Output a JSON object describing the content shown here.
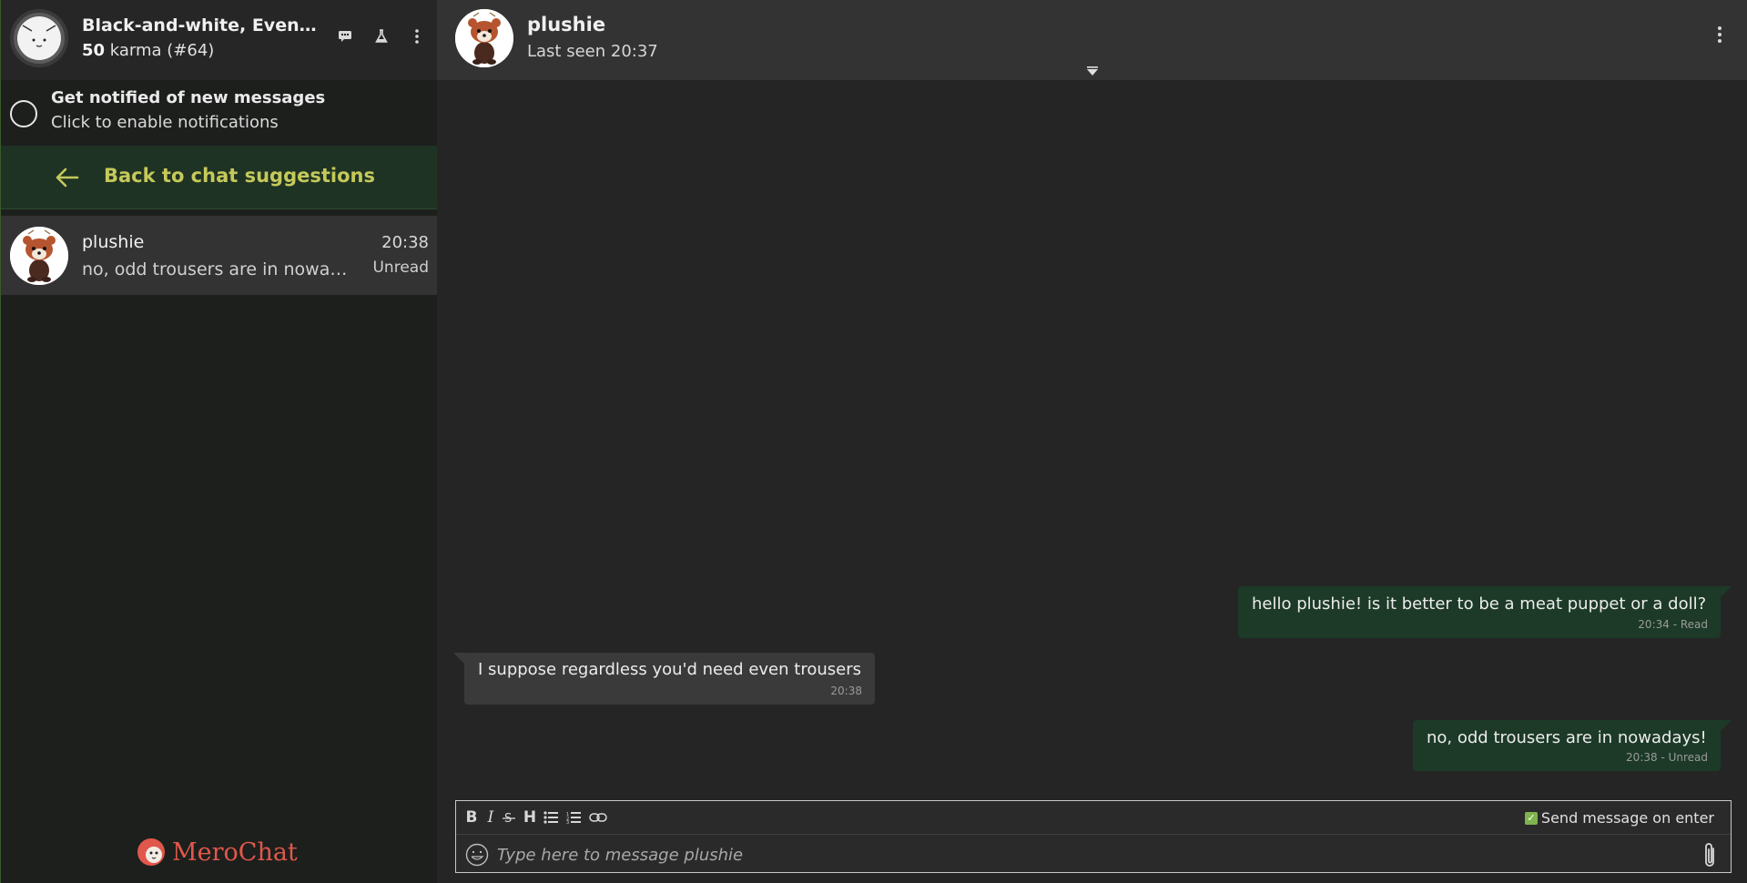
{
  "profile": {
    "name": "Black-and-white, Even ...",
    "karma_value": "50",
    "karma_rest": " karma (#64)"
  },
  "notification": {
    "title": "Get notified of new messages",
    "subtitle": "Click to enable notifications"
  },
  "back": {
    "label": "Back to chat suggestions"
  },
  "chats": [
    {
      "name": "plushie",
      "preview": "no, odd trousers are in nowadays!",
      "time": "20:38",
      "status": "Unread"
    }
  ],
  "logo": {
    "text": "MeroChat"
  },
  "header": {
    "name": "plushie",
    "last_seen": "Last seen 20:37"
  },
  "messages": [
    {
      "direction": "out",
      "text": "hello plushie! is it better to be a meat puppet or a doll?",
      "meta": "20:34 - Read"
    },
    {
      "direction": "in",
      "text": "I suppose regardless you'd need even trousers",
      "meta": "20:38"
    },
    {
      "direction": "out",
      "text": "no, odd trousers are in nowadays!",
      "meta": "20:38 - Unread"
    }
  ],
  "composer": {
    "send_on_enter_label": "Send message on enter",
    "send_on_enter_checked": true,
    "placeholder": "Type here to message plushie"
  },
  "colors": {
    "accent_green": "#1f3324",
    "back_text": "#c5c95a",
    "outgoing_bubble": "#1c3a27",
    "incoming_bubble": "#3a3a3a",
    "logo": "#e0584b"
  }
}
